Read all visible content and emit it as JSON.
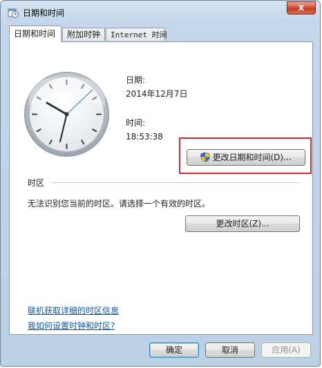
{
  "window": {
    "title": "日期和时间",
    "close_label": "x"
  },
  "tabs": [
    {
      "label": "日期和时间"
    },
    {
      "label": "附加时钟"
    },
    {
      "label": "Internet 时间"
    }
  ],
  "date": {
    "label": "日期:",
    "value": "2014年12月7日"
  },
  "time": {
    "label": "时间:",
    "value": "18:53:38"
  },
  "change_datetime_button": "更改日期和时间(D)...",
  "timezone": {
    "section_label": "时区",
    "message": "无法识别您当前的时区。请选择一个有效的时区。",
    "change_button": "更改时区(Z)..."
  },
  "links": {
    "online_info": "联机获取详细的时区信息",
    "how_to": "我如何设置时钟和时区?"
  },
  "footer": {
    "ok": "确定",
    "cancel": "取消",
    "apply": "应用(A)"
  },
  "colors": {
    "highlight": "#d0282e",
    "link": "#0b57a6"
  },
  "icons": {
    "title": "calendar-clock-icon",
    "shield": "uac-shield-icon"
  }
}
